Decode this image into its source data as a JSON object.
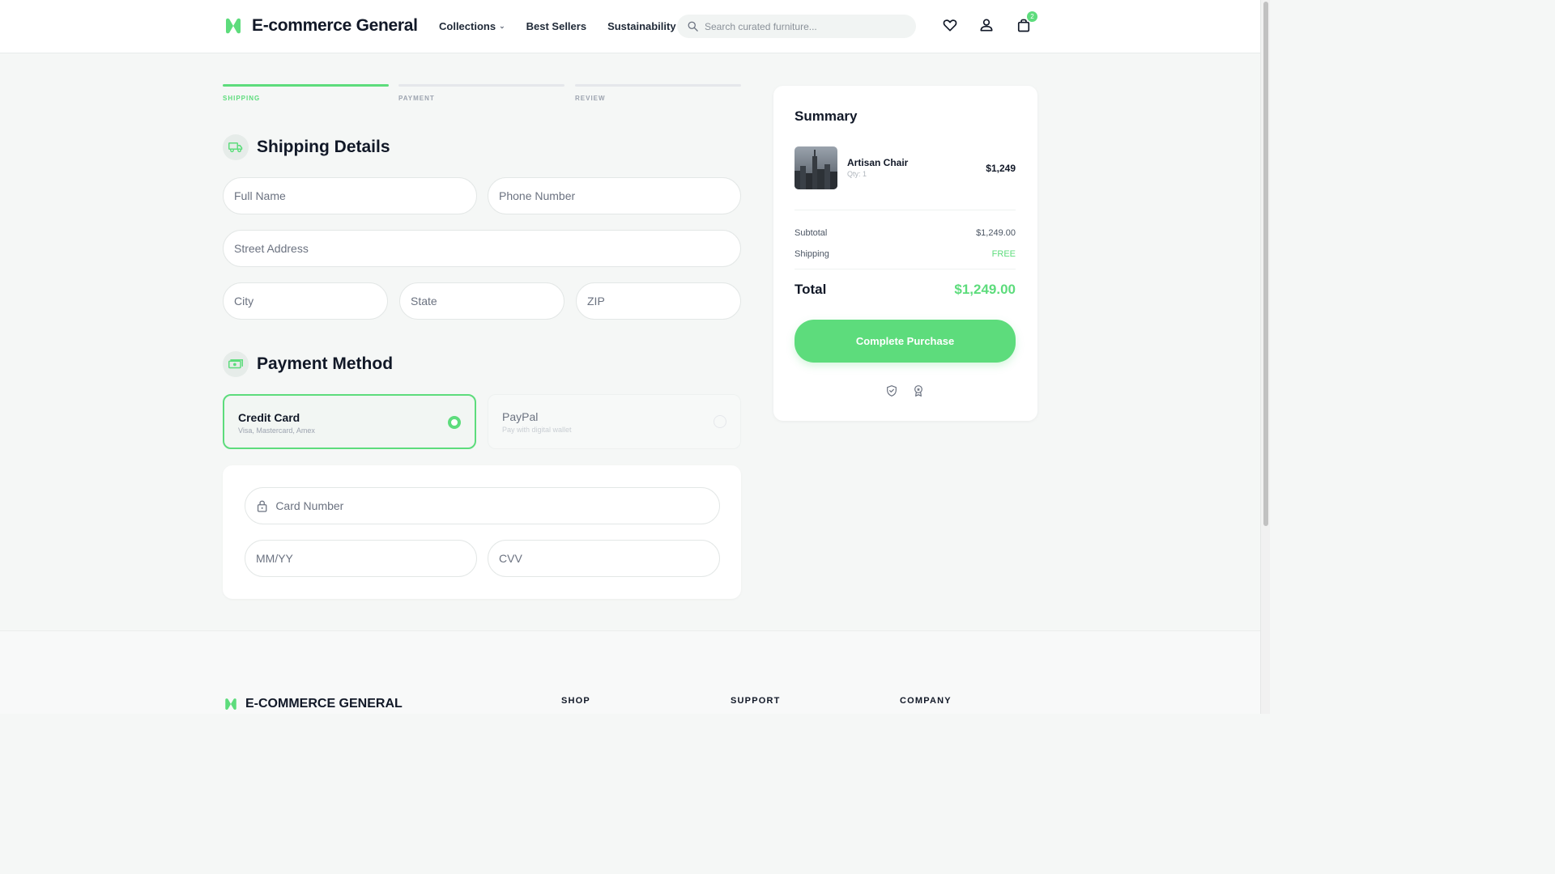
{
  "brand": {
    "name": "E-commerce General",
    "footer_name": "E-COMMERCE GENERAL",
    "accent": "#5ddc7c"
  },
  "nav": {
    "collections": "Collections",
    "best_sellers": "Best Sellers",
    "sustainability": "Sustainability"
  },
  "search": {
    "placeholder": "Search curated furniture..."
  },
  "header_icons": [
    "heart-icon",
    "user-icon",
    "shopping-bag-icon"
  ],
  "cart": {
    "count": "2"
  },
  "steps": [
    {
      "label": "SHIPPING",
      "active": true
    },
    {
      "label": "PAYMENT",
      "active": false
    },
    {
      "label": "REVIEW",
      "active": false
    }
  ],
  "shipping": {
    "title": "Shipping Details",
    "icon": "truck-icon",
    "full_name": "Full Name",
    "phone": "Phone Number",
    "street": "Street Address",
    "city": "City",
    "state": "State",
    "zip": "ZIP"
  },
  "payment": {
    "title": "Payment Method",
    "icon": "money-icon",
    "options": [
      {
        "name": "Credit Card",
        "sub": "Visa, Mastercard, Amex",
        "selected": true
      },
      {
        "name": "PayPal",
        "sub": "Pay with digital wallet",
        "selected": false
      }
    ],
    "card_number": "Card Number",
    "expiry": "MM/YY",
    "cvv": "CVV"
  },
  "summary": {
    "title": "Summary",
    "item": {
      "name": "Artisan Chair",
      "qty": "Qty: 1",
      "price": "$1,249"
    },
    "subtotal_label": "Subtotal",
    "subtotal_value": "$1,249.00",
    "shipping_label": "Shipping",
    "shipping_value": "FREE",
    "total_label": "Total",
    "total_value": "$1,249.00",
    "cta": "Complete Purchase",
    "trust_icons": [
      "shield-check-icon",
      "award-icon"
    ]
  },
  "footer": {
    "columns": [
      "SHOP",
      "SUPPORT",
      "COMPANY"
    ]
  }
}
